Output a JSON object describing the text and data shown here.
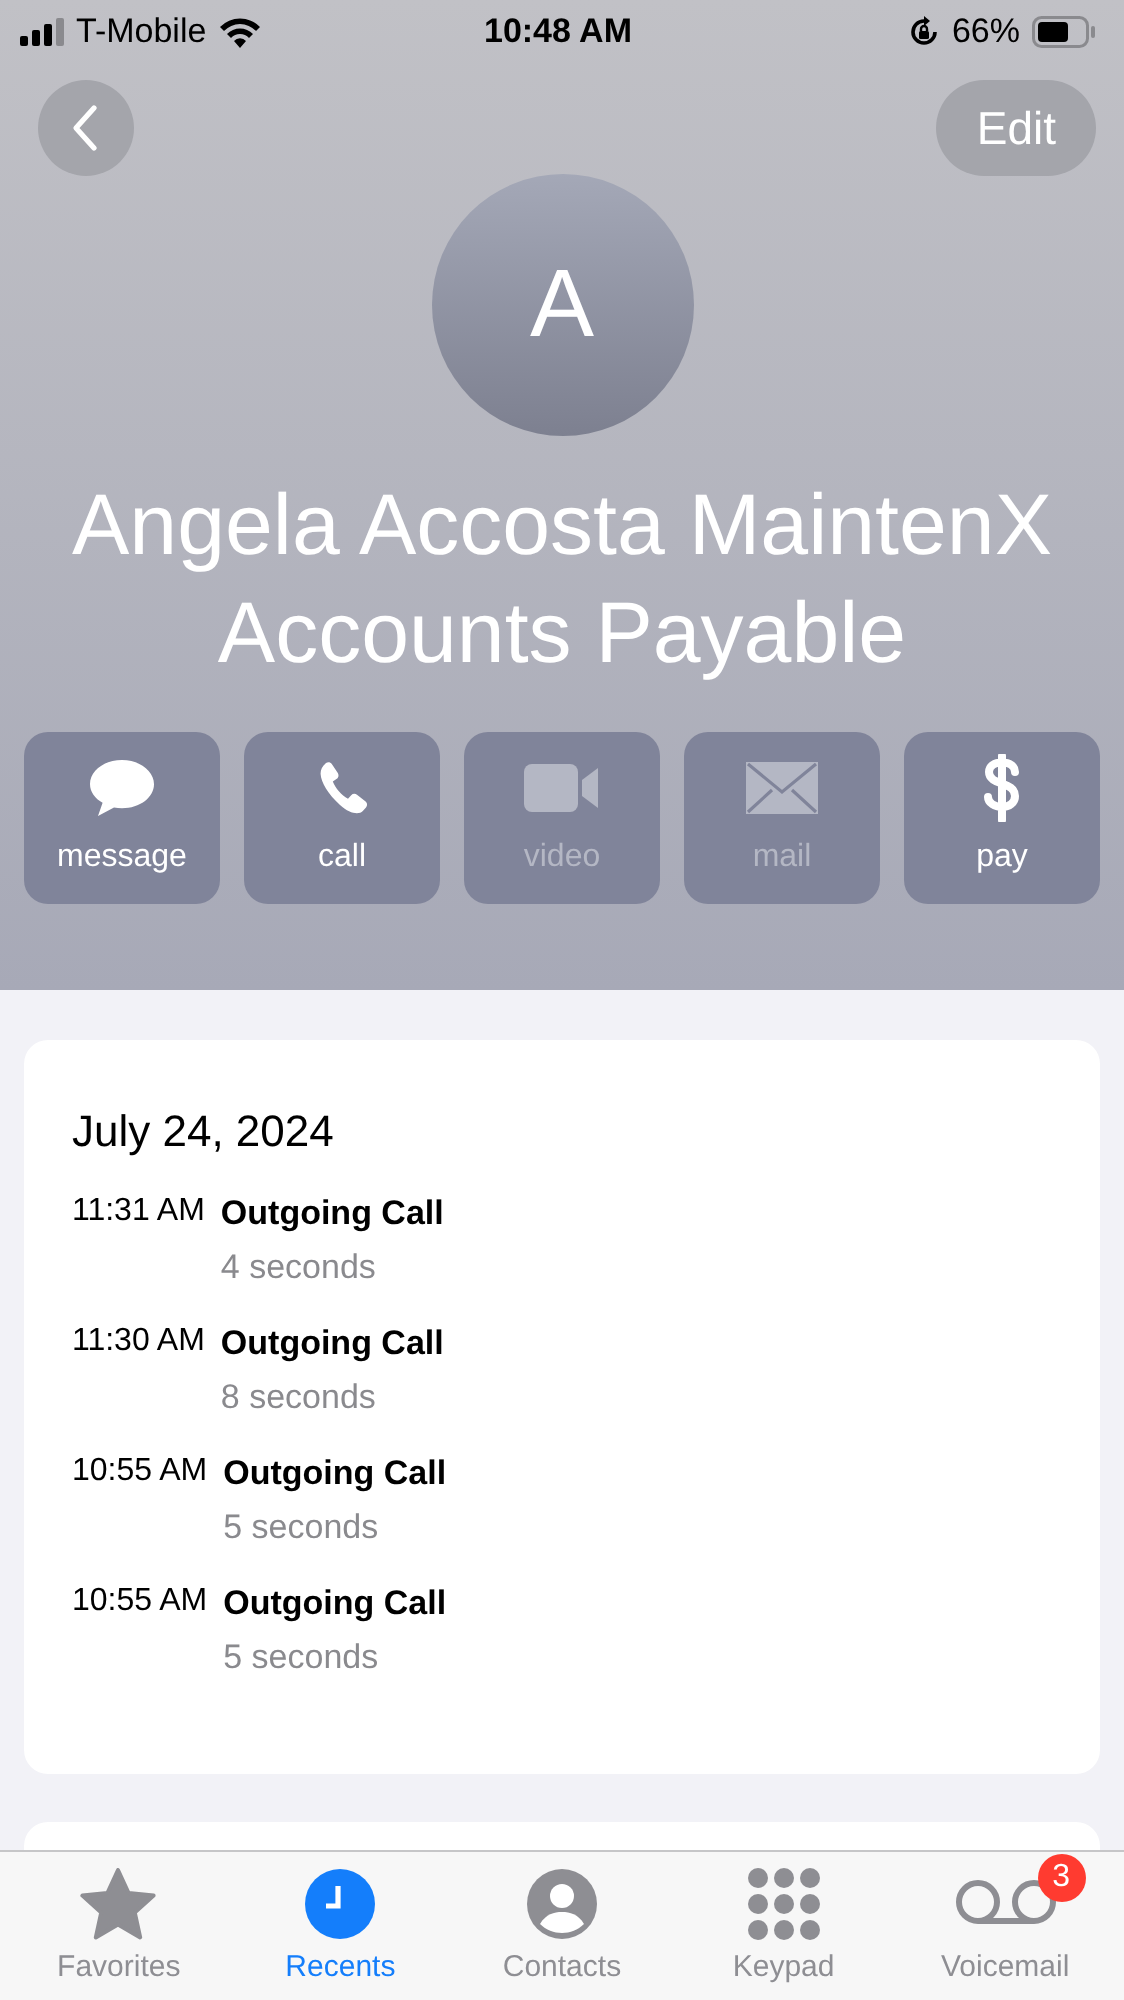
{
  "status_bar": {
    "carrier": "T-Mobile",
    "time": "10:48 AM",
    "battery": "66%"
  },
  "nav": {
    "edit": "Edit"
  },
  "contact": {
    "initial": "A",
    "name": "Angela Accosta MaintenX Accounts Payable"
  },
  "actions": [
    {
      "kind": "message",
      "label": "message",
      "disabled": false
    },
    {
      "kind": "call",
      "label": "call",
      "disabled": false
    },
    {
      "kind": "video",
      "label": "video",
      "disabled": true
    },
    {
      "kind": "mail",
      "label": "mail",
      "disabled": true
    },
    {
      "kind": "pay",
      "label": "pay",
      "disabled": false
    }
  ],
  "recents": {
    "date": "July 24, 2024",
    "calls": [
      {
        "time": "11:31 AM",
        "type": "Outgoing Call",
        "duration": "4 seconds"
      },
      {
        "time": "11:30 AM",
        "type": "Outgoing Call",
        "duration": "8 seconds"
      },
      {
        "time": "10:55 AM",
        "type": "Outgoing Call",
        "duration": "5 seconds"
      },
      {
        "time": "10:55 AM",
        "type": "Outgoing Call",
        "duration": "5 seconds"
      }
    ]
  },
  "tab_bar": [
    {
      "kind": "favorites",
      "label": "Favorites",
      "selected": false
    },
    {
      "kind": "recents",
      "label": "Recents",
      "selected": true
    },
    {
      "kind": "contacts",
      "label": "Contacts",
      "selected": false
    },
    {
      "kind": "keypad",
      "label": "Keypad",
      "selected": false
    },
    {
      "kind": "voicemail",
      "label": "Voicemail",
      "selected": false,
      "badge": "3"
    }
  ]
}
